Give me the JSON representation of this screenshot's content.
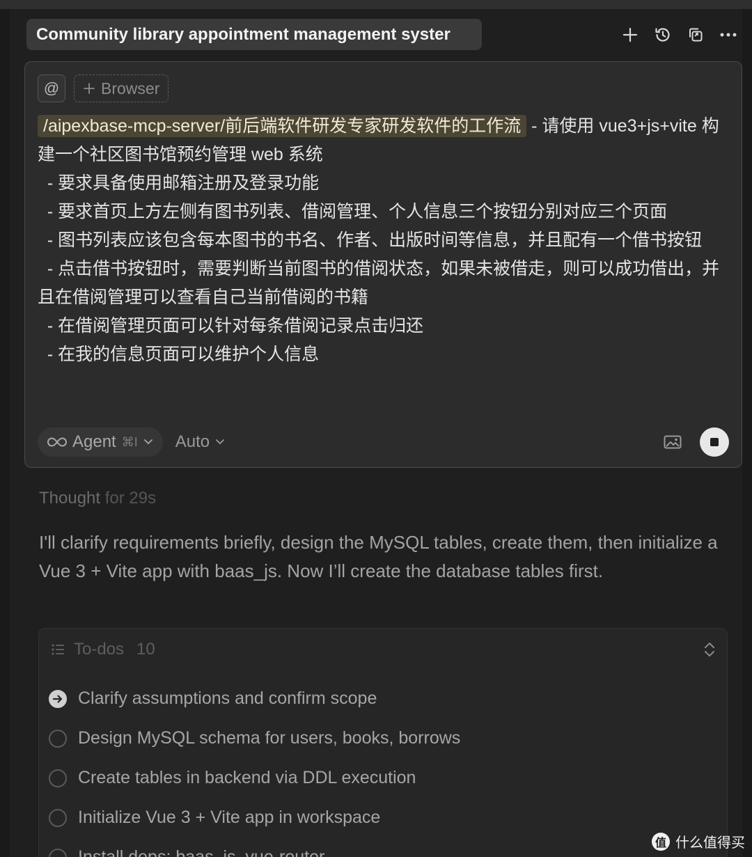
{
  "header": {
    "title": "Community library appointment management syster",
    "icons": [
      "plus-icon",
      "history-icon",
      "copy-icon",
      "more-icon"
    ]
  },
  "composer": {
    "at_label": "@",
    "browser_chip": "Browser",
    "mention": "/aipexbase-mcp-server/前后端软件研发专家研发软件的工作流",
    "prompt_lines": [
      " - 请使用 vue3+js+vite 构建一个社区图书馆预约管理 web 系统",
      "  - 要求具备使用邮箱注册及登录功能",
      "  - 要求首页上方左侧有图书列表、借阅管理、个人信息三个按钮分别对应三个页面",
      "  - 图书列表应该包含每本图书的书名、作者、出版时间等信息，并且配有一个借书按钮",
      "  - 点击借书按钮时，需要判断当前图书的借阅状态，如果未被借走，则可以成功借出，并且在借阅管理可以查看自己当前借阅的书籍",
      "  - 在借阅管理页面可以针对每条借阅记录点击归还",
      "  - 在我的信息页面可以维护个人信息"
    ],
    "agent_label": "Agent",
    "agent_shortcut": "⌘I",
    "model_label": "Auto"
  },
  "thought": {
    "label": "Thought",
    "duration": "for 29s"
  },
  "reply": "I'll clarify requirements briefly, design the MySQL tables, create them, then initialize a Vue 3 + Vite app with baas_js. Now I’ll create the database tables first.",
  "todos": {
    "title": "To-dos",
    "count": "10",
    "items": [
      {
        "label": "Clarify assumptions and confirm scope",
        "state": "in-progress"
      },
      {
        "label": "Design MySQL schema for users, books, borrows",
        "state": "pending"
      },
      {
        "label": "Create tables in backend via DDL execution",
        "state": "pending"
      },
      {
        "label": "Initialize Vue 3 + Vite app in workspace",
        "state": "pending"
      },
      {
        "label": "Install deps: baas_js, vue-router",
        "state": "pending"
      }
    ]
  },
  "watermark": {
    "logo": "值",
    "text": "什么值得买"
  }
}
